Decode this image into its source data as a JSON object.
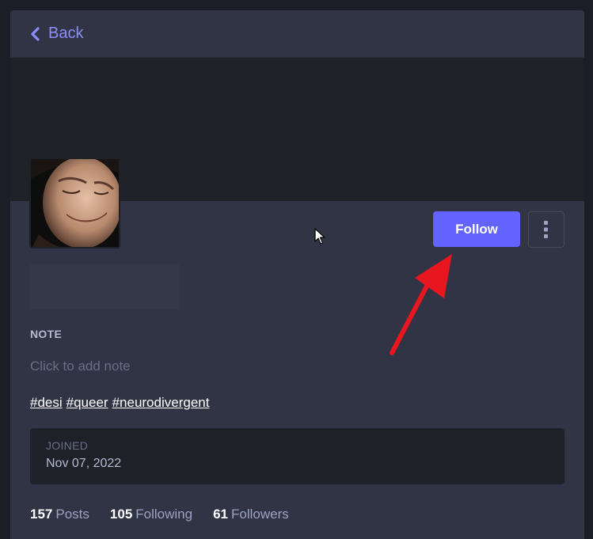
{
  "nav": {
    "back_label": "Back"
  },
  "profile": {
    "follow_label": "Follow",
    "note_label": "NOTE",
    "note_placeholder": "Click to add note",
    "tags": [
      "#desi",
      "#queer",
      "#neurodivergent"
    ],
    "joined_label": "JOINED",
    "joined_date": "Nov 07, 2022",
    "stats": [
      {
        "count": "157",
        "label": "Posts"
      },
      {
        "count": "105",
        "label": "Following"
      },
      {
        "count": "61",
        "label": "Followers"
      }
    ]
  },
  "colors": {
    "accent": "#6364ff",
    "link": "#8c8dff",
    "annotation": "#e8161f"
  }
}
